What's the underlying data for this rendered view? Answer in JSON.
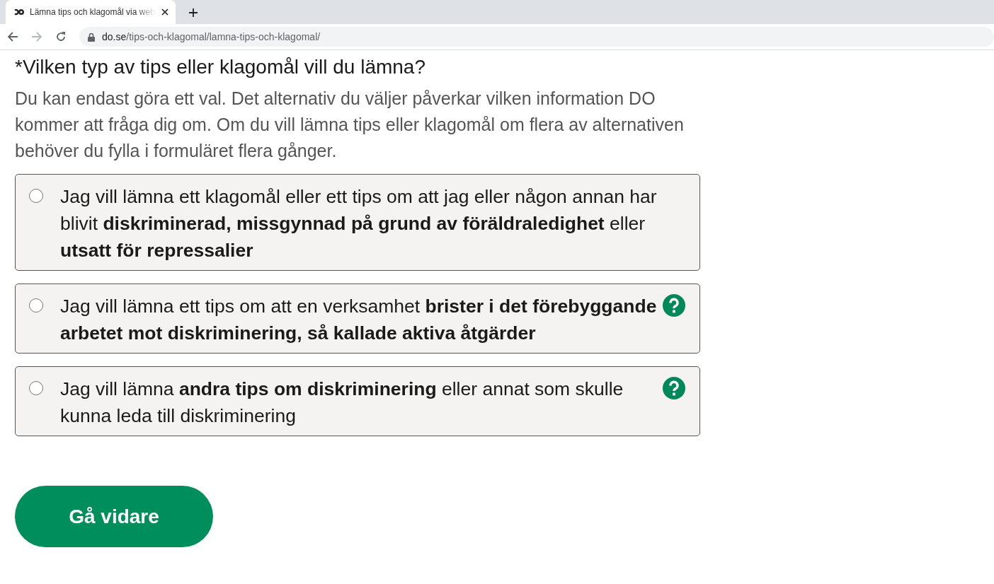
{
  "browser": {
    "tab": {
      "title": "Lämna tips och klagomål via web"
    },
    "address": {
      "domain": "do.se",
      "path": "/tips-och-klagomal/lamna-tips-och-klagomal/"
    }
  },
  "question": {
    "title": "*Vilken typ av tips eller klagomål vill du lämna?",
    "help": "Du kan endast göra ett val. Det alternativ du väljer påverkar vilken information DO kommer att fråga dig om. Om du vill lämna tips eller klagomål om flera av alternativen behöver du fylla i formuläret flera gånger."
  },
  "options": [
    {
      "text": "Jag vill lämna ett klagomål eller ett tips om att jag eller någon annan har blivit **diskriminerad, missgynnad på grund av föräldraledighet** eller **utsatt för repressalier**",
      "selected": false,
      "help": false
    },
    {
      "text": "Jag vill lämna ett tips om att en verksamhet **brister i det förebyggande arbetet mot diskriminering, så kallade aktiva åtgärder**",
      "selected": false,
      "help": true
    },
    {
      "text": "Jag vill lämna **andra tips om diskriminering** eller annat som skulle kunna leda till diskriminering",
      "selected": false,
      "help": true
    }
  ],
  "continue_button": "Gå vidare"
}
